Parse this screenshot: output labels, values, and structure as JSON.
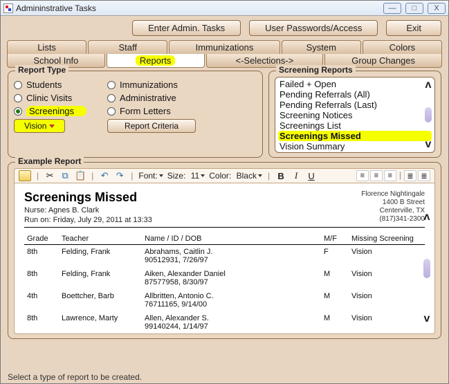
{
  "title": "Admininstrative Tasks",
  "winbtns": {
    "min": "—",
    "max": "□",
    "close": "X"
  },
  "topbtns": {
    "enter": "Enter Admin. Tasks",
    "passwords": "User Passwords/Access",
    "exit": "Exit"
  },
  "tabs1": [
    "Lists",
    "Staff",
    "Immunizations",
    "System",
    "Colors"
  ],
  "tabs2": [
    {
      "label": "School Info",
      "active": false
    },
    {
      "label": "Reports",
      "active": true,
      "hl": true
    },
    {
      "label": "<-Selections->",
      "active": false
    },
    {
      "label": "Group Changes",
      "active": false
    }
  ],
  "rt": {
    "legend": "Report Type",
    "col1": [
      {
        "label": "Students",
        "sel": false
      },
      {
        "label": "Clinic Visits",
        "sel": false
      },
      {
        "label": "Screenings",
        "sel": true,
        "hl": true
      }
    ],
    "col2": [
      {
        "label": "Immunizations",
        "sel": false
      },
      {
        "label": "Administrative",
        "sel": false
      },
      {
        "label": "Form Letters",
        "sel": false
      }
    ],
    "vision": "Vision",
    "criteria": "Report Criteria"
  },
  "sr": {
    "legend": "Screening Reports",
    "items": [
      {
        "label": "Failed + Open"
      },
      {
        "label": "Pending Referrals (All)"
      },
      {
        "label": "Pending Referrals (Last)"
      },
      {
        "label": "Screening Notices"
      },
      {
        "label": "Screenings List"
      },
      {
        "label": "Screenings Missed",
        "hl": true
      },
      {
        "label": "Vision Summary"
      }
    ]
  },
  "example": {
    "legend": "Example Report",
    "toolbar": {
      "font": "Font:",
      "size": "Size:",
      "sizeval": "11",
      "color": "Color:",
      "colorval": "Black",
      "b": "B",
      "i": "I",
      "u": "U"
    },
    "title": "Screenings Missed",
    "nurse": "Nurse: Agnes B. Clark",
    "run": "Run on: Friday, July 29, 2011 at 13:33",
    "org": "Florence Nightingale",
    "addr1": "1400 B Street",
    "addr2": "Centerville, TX",
    "phone": "(817)341-2300",
    "cols": {
      "grade": "Grade",
      "teacher": "Teacher",
      "name": "Name / ID / DOB",
      "mf": "M/F",
      "miss": "Missing Screening"
    },
    "rows": [
      {
        "grade": "8th",
        "teacher": "Felding, Frank",
        "name": "Abrahams, Caitlin J.",
        "id": "90512931, 7/26/97",
        "mf": "F",
        "miss": "Vision"
      },
      {
        "grade": "8th",
        "teacher": "Felding, Frank",
        "name": "Aiken, Alexander Daniel",
        "id": "87577958, 8/30/97",
        "mf": "M",
        "miss": "Vision"
      },
      {
        "grade": "4th",
        "teacher": "Boettcher, Barb",
        "name": "Allbritten, Antonio C.",
        "id": "76711165, 9/14/00",
        "mf": "M",
        "miss": "Vision"
      },
      {
        "grade": "8th",
        "teacher": "Lawrence, Marty",
        "name": "Allen, Alexander S.",
        "id": "99140244, 1/14/97",
        "mf": "M",
        "miss": "Vision"
      }
    ]
  },
  "status": "Select a type of report to be created.",
  "caret": {
    "up": "ʌ",
    "down": "v"
  }
}
